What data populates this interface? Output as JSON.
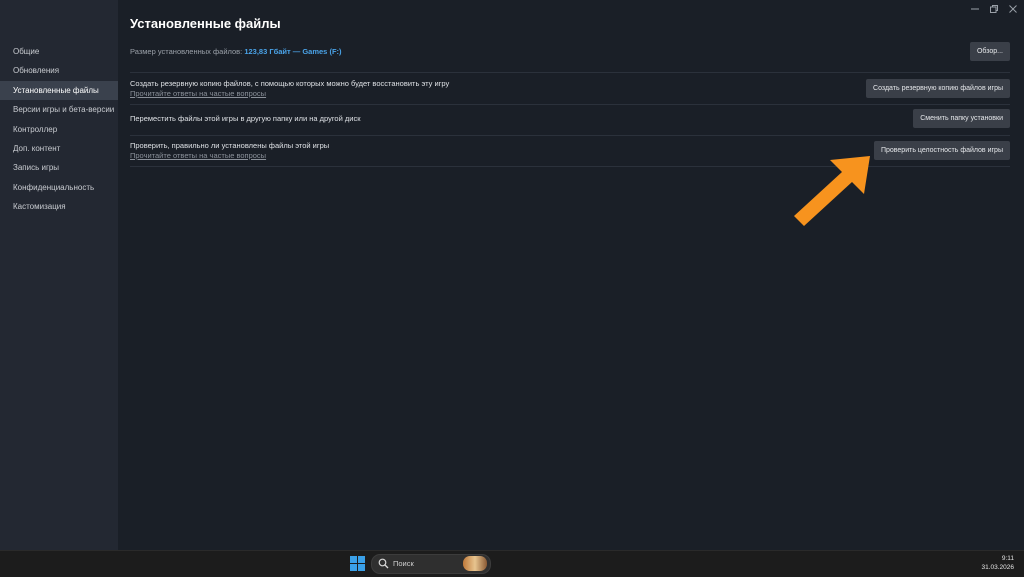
{
  "window": {
    "title": "Установленные файлы"
  },
  "sidebar": {
    "items": [
      {
        "label": "Общие"
      },
      {
        "label": "Обновления"
      },
      {
        "label": "Установленные файлы",
        "active": true
      },
      {
        "label": "Версии игры и бета-версии"
      },
      {
        "label": "Контроллер"
      },
      {
        "label": "Доп. контент"
      },
      {
        "label": "Запись игры"
      },
      {
        "label": "Конфиденциальность"
      },
      {
        "label": "Кастомизация"
      }
    ]
  },
  "main": {
    "size_row": {
      "label": "Размер установленных файлов:",
      "value": "123,83 Гбайт — Games (F:)",
      "button": "Обзор..."
    },
    "backup_row": {
      "text": "Создать резервную копию файлов, с помощью которых можно будет восстановить эту игру",
      "link": "Прочитайте ответы на частые вопросы",
      "button": "Создать резервную копию файлов игры"
    },
    "move_row": {
      "text": "Переместить файлы этой игры в другую папку или на другой диск",
      "button": "Сменить папку установки"
    },
    "verify_row": {
      "text": "Проверить, правильно ли установлены файлы этой игры",
      "link": "Прочитайте ответы на частые вопросы",
      "button": "Проверить целостность файлов игры"
    }
  },
  "annotation": {
    "arrow_color": "#f7931e",
    "icon": "arrow-pointer-icon"
  },
  "colors": {
    "background": "#1a1f27",
    "sidebar": "#232832",
    "accent": "#4aa3e8"
  },
  "taskbar": {
    "search_placeholder": "Поиск",
    "time": "9:11",
    "date": "31.03.2026"
  }
}
